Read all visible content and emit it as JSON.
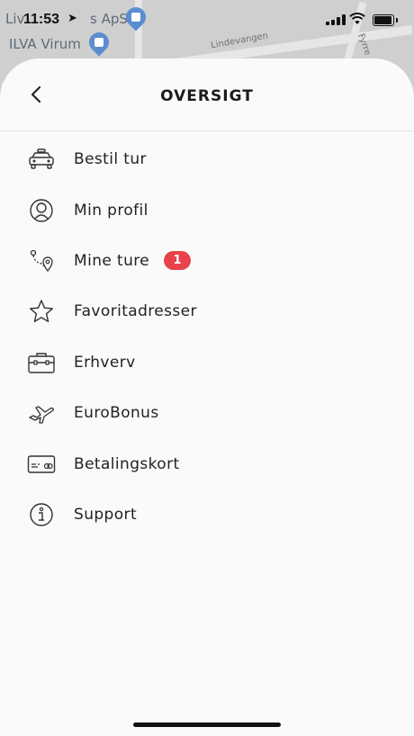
{
  "status_bar": {
    "time": "11:53"
  },
  "map": {
    "labels": [
      "Liv",
      "s ApS",
      "ILVA Virum"
    ],
    "street_labels": [
      "Lindevangen",
      "Fyrre"
    ]
  },
  "header": {
    "title": "OVERSIGT",
    "back_icon": "chevron-left-icon"
  },
  "menu": {
    "items": [
      {
        "label": "Bestil tur",
        "icon": "taxi-icon"
      },
      {
        "label": "Min profil",
        "icon": "user-icon"
      },
      {
        "label": "Mine ture",
        "icon": "route-icon",
        "badge": "1"
      },
      {
        "label": "Favoritadresser",
        "icon": "star-icon"
      },
      {
        "label": "Erhverv",
        "icon": "briefcase-icon"
      },
      {
        "label": "EuroBonus",
        "icon": "airplane-icon"
      },
      {
        "label": "Betalingskort",
        "icon": "card-icon"
      },
      {
        "label": "Support",
        "icon": "info-icon"
      }
    ]
  },
  "colors": {
    "badge": "#e8434b",
    "sheet": "#fafafa",
    "text": "#222222"
  }
}
